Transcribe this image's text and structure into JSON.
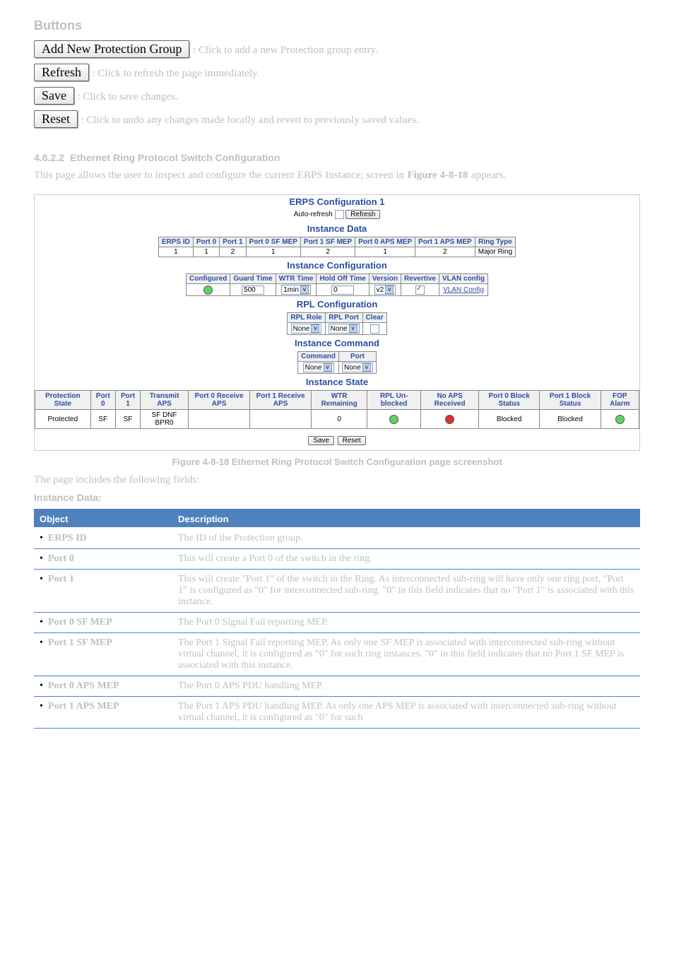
{
  "top_buttons": {
    "add_group": "Add New Protection Group",
    "add_group_after": ": Click to add a new Protection group entry.",
    "refresh": "Refresh",
    "refresh_after": ": Click to refresh the page immediately.",
    "save": "Save",
    "save_after": ": Click to save changes.",
    "reset": "Reset",
    "reset_after": ": Click to undo any changes made locally and revert to previously saved values."
  },
  "subsection": {
    "number": "4.8.2.2",
    "title": "Ethernet Ring Protocol Switch Configuration",
    "intro": "This page allows the user to inspect and configure the current ERPS Instance; screen in",
    "fig_ref_a": "Figure 4-8-18",
    "intro_tail": " appears."
  },
  "config_page": {
    "title": "ERPS Configuration 1",
    "auto_refresh_label": "Auto-refresh",
    "refresh_btn": "Refresh",
    "instance_data": {
      "heading": "Instance Data",
      "headers": [
        "ERPS ID",
        "Port 0",
        "Port 1",
        "Port 0 SF MEP",
        "Port 1 SF MEP",
        "Port 0 APS MEP",
        "Port 1 APS MEP",
        "Ring Type"
      ],
      "row": [
        "1",
        "1",
        "2",
        "1",
        "2",
        "1",
        "2",
        "Major Ring"
      ]
    },
    "instance_config": {
      "heading": "Instance Configuration",
      "headers": [
        "Configured",
        "Guard Time",
        "WTR Time",
        "Hold Off Time",
        "Version",
        "Revertive",
        "VLAN config"
      ],
      "guard_time": "500",
      "wtr_time": "1min",
      "hold_off": "0",
      "version": "v2",
      "vlan_config_label": "VLAN Config"
    },
    "rpl": {
      "heading": "RPL Configuration",
      "headers": [
        "RPL Role",
        "RPL Port",
        "Clear"
      ],
      "role": "None",
      "port": "None"
    },
    "command": {
      "heading": "Instance Command",
      "headers": [
        "Command",
        "Port"
      ],
      "command": "None",
      "port": "None"
    },
    "state": {
      "heading": "Instance State",
      "headers": [
        "Protection State",
        "Port 0",
        "Port 1",
        "Transmit APS",
        "Port 0 Receive APS",
        "Port 1 Receive APS",
        "WTR Remaining",
        "RPL Un-blocked",
        "No APS Received",
        "Port 0 Block Status",
        "Port 1 Block Status",
        "FOP Alarm"
      ],
      "row": {
        "protection_state": "Protected",
        "port0": "SF",
        "port1": "SF",
        "transmit_aps": "SF DNF BPR0",
        "p0_recv": "",
        "p1_recv": "",
        "wtr_remaining": "0",
        "rpl_dot": "green",
        "noaps_dot": "red",
        "p0_block": "Blocked",
        "p1_block": "Blocked",
        "fop_dot": "green"
      }
    },
    "bottom_buttons": {
      "save": "Save",
      "reset": "Reset"
    }
  },
  "figure_caption": {
    "ref": "Figure 4-8-18",
    "tail": " Ethernet Ring Protocol Switch Configuration page screenshot"
  },
  "desc_intro": "The page includes the following fields:",
  "instance_data_heading_word": "Instance Data:",
  "desc_table": {
    "head": [
      "Object",
      "Description"
    ],
    "rows": [
      {
        "obj": "ERPS ID",
        "desc": "The ID of the Protection group."
      },
      {
        "obj": "Port 0",
        "desc": "This will create a Port 0 of the switch in the ring."
      },
      {
        "obj": "Port 1",
        "desc": "This will create \"Port 1\" of the switch in the Ring. As interconnected sub-ring will have only one ring port, \"Port 1\" is configured as \"0\" for interconnected sub-ring. \"0\" in this field indicates that no \"Port 1\" is associated with this instance."
      },
      {
        "obj": "Port 0 SF MEP",
        "desc": "The Port 0 Signal Fail reporting MEP."
      },
      {
        "obj": "Port 1 SF MEP",
        "desc": "The Port 1 Signal Fail reporting MEP. As only one SF MEP is associated with interconnected sub-ring without virtual channel, it is configured as \"0\" for such ring instances. \"0\" in this field indicates that no Port 1 SF MEP is associated with this instance."
      },
      {
        "obj": "Port 0 APS MEP",
        "desc": "The Port 0 APS PDU handling MEP."
      },
      {
        "obj": "Port 1 APS MEP",
        "desc": "The Port 1 APS PDU handling MEP. As only one APS MEP is associated with interconnected sub-ring without virtual channel, it is configured as \"0\" for such"
      }
    ]
  }
}
